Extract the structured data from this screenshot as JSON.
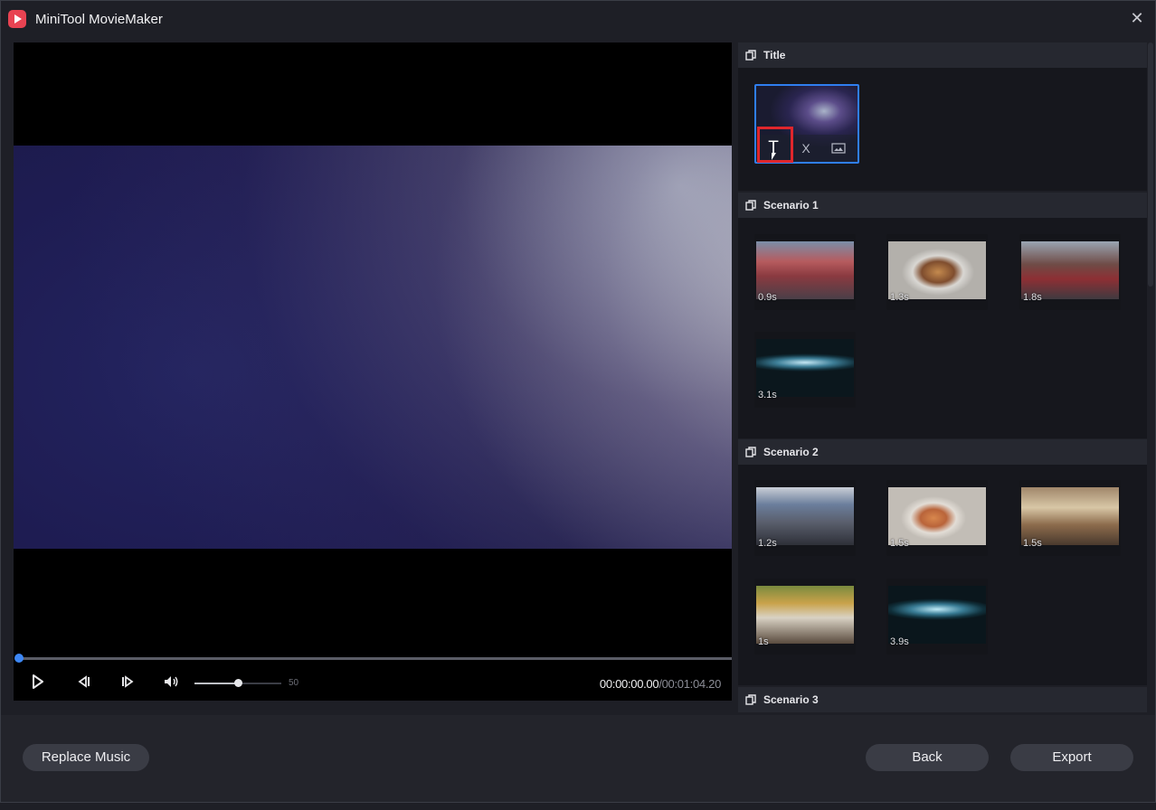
{
  "app": {
    "title": "MiniTool MovieMaker",
    "close_glyph": "✕"
  },
  "player": {
    "current_time": "00:00:00.00",
    "total_time": "/00:01:04.20",
    "volume": 50,
    "volume_label": "50",
    "progress": 0.0
  },
  "panel": {
    "sections": [
      {
        "title": "Title"
      },
      {
        "title": "Scenario 1"
      },
      {
        "title": "Scenario 2"
      },
      {
        "title": "Scenario 3"
      }
    ],
    "title_tools": [
      "T",
      "X"
    ],
    "scenario1_clips": [
      "0.9s",
      "1.3s",
      "1.8s",
      "3.1s"
    ],
    "scenario2_clips": [
      "1.2s",
      "1.5s",
      "1.5s",
      "1s",
      "3.9s"
    ]
  },
  "buttons": {
    "replace_music": "Replace Music",
    "back": "Back",
    "export": "Export"
  },
  "colors": {
    "accent": "#2f7ef0",
    "highlight": "#e0262c",
    "logo": "#e84352"
  }
}
